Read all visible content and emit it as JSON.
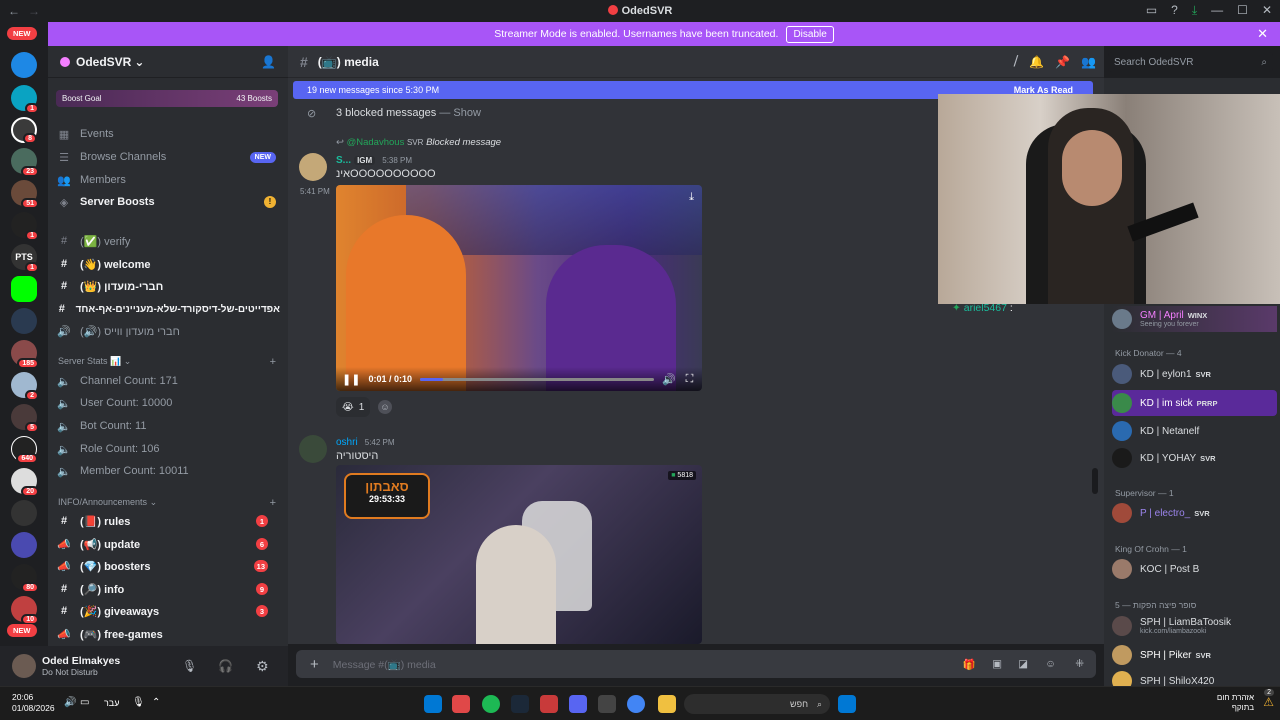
{
  "window": {
    "title": "OdedSVR"
  },
  "banner": {
    "text": "Streamer Mode is enabled. Usernames have been truncated.",
    "button": "Disable"
  },
  "guild_pills": {
    "top": "NEW",
    "bottom": "NEW"
  },
  "guild_badges": [
    "1",
    "8",
    "23",
    "51",
    "1",
    "1",
    "185",
    "2",
    "5",
    "640",
    "20",
    "80",
    "10",
    "1"
  ],
  "server": {
    "name": "OdedSVR",
    "boost_goal": "Boost Goal",
    "boost_count": "43 Boosts"
  },
  "nav": [
    {
      "label": "Events",
      "icon": "calendar-icon"
    },
    {
      "label": "Browse Channels",
      "icon": "browse-icon",
      "badge": "NEW"
    },
    {
      "label": "Members",
      "icon": "members-icon"
    },
    {
      "label": "Server Boosts",
      "icon": "boost-icon",
      "alert": "!"
    }
  ],
  "channels_top": [
    {
      "label": "(✅) verify",
      "muted": true
    },
    {
      "label": "(👋) welcome",
      "bold": true
    },
    {
      "label": "(👑) חברי-מועדון",
      "bold": true
    },
    {
      "label": "אפדייטים-של-דיסקורד-שלא-מעניינים-אף-אחד",
      "bold": true
    },
    {
      "label": "(🔊) חברי מועדון ווייס",
      "muted": true
    }
  ],
  "stats_category": "Server Stats 📊",
  "stats": [
    "Channel Count: 171",
    "User Count: 10000",
    "Bot Count: 11",
    "Role Count: 106",
    "Member Count: 10011"
  ],
  "info_category": "INFO/Announcements",
  "channels_info": [
    {
      "label": "(📕) rules",
      "badge": "1"
    },
    {
      "label": "(📢) update",
      "badge": "6"
    },
    {
      "label": "(💎) boosters",
      "badge": "13"
    },
    {
      "label": "(🔎) info",
      "badge": "9"
    },
    {
      "label": "(🎉) giveaways",
      "badge": "3"
    },
    {
      "label": "(🎮) free-games",
      "badge": ""
    }
  ],
  "user": {
    "name": "Oded Elmakyes",
    "status": "Do Not Disturb"
  },
  "channel": {
    "name": "(📺) media"
  },
  "search": {
    "placeholder": "Search OdedSVR"
  },
  "new_messages": {
    "text": "19 new messages since 5:30 PM",
    "action": "Mark As Read"
  },
  "blocked": {
    "text": "3 blocked messages",
    "show": "— Show"
  },
  "reply": {
    "user": "@Nadavhous",
    "tag": "SVR",
    "text": "Blocked message"
  },
  "msg1": {
    "author": "S...",
    "tag": "IGM",
    "time": "5:38 PM",
    "text": "אינOOOOOOOOOO",
    "time2": "5:41 PM"
  },
  "video1": {
    "progress": "0:01 / 0:10",
    "progress_fraction": 0.1
  },
  "reaction": {
    "count": "1"
  },
  "msg2": {
    "author": "oshri",
    "time": "5:42 PM",
    "text": "היסטוריה"
  },
  "video2": {
    "overlay": "סאבתון",
    "timer": "29:53:33",
    "viewers": "5818"
  },
  "composer": {
    "placeholder": "Message #(📺) media"
  },
  "member_floating": {
    "name": "ariel5467",
    "suffix": ":"
  },
  "members": [
    {
      "type": "row",
      "name": "GM | April",
      "tag": "WINX",
      "sub": "Seeing you forever",
      "color": "#f47fff",
      "hl": true
    },
    {
      "type": "cat",
      "name": "Kick Donator — 4"
    },
    {
      "type": "row",
      "name": "KD | eylon1",
      "tag": "SVR",
      "color": "#dbdee1"
    },
    {
      "type": "row",
      "name": "KD | im sick",
      "tag": "PRRP",
      "color": "#ffffff",
      "hl2": true
    },
    {
      "type": "row",
      "name": "KD | Netanelf",
      "tag": "",
      "color": "#dbdee1"
    },
    {
      "type": "row",
      "name": "KD | YOHAY",
      "tag": "SVR",
      "color": "#dbdee1"
    },
    {
      "type": "cat",
      "name": "Supervisor — 1"
    },
    {
      "type": "row",
      "name": "P | electro_",
      "tag": "SVR",
      "color": "#9b84ec"
    },
    {
      "type": "cat",
      "name": "King Of Crohn — 1"
    },
    {
      "type": "row",
      "name": "KOC | Post B",
      "tag": "",
      "color": "#dbdee1"
    },
    {
      "type": "cat",
      "name": "סופר פיצה הפקות — 5"
    },
    {
      "type": "row",
      "name": "SPH | LiamBaToosik",
      "tag": "",
      "sub": "kick.com/liambazooki",
      "color": "#dbdee1"
    },
    {
      "type": "row",
      "name": "SPH | Piker",
      "tag": "SVR",
      "color": "#ffffff"
    },
    {
      "type": "row",
      "name": "SPH | ShiloX420",
      "tag": "",
      "color": "#dbdee1"
    }
  ],
  "taskbar": {
    "time": "20:06",
    "date": "01/08/2026",
    "lang": "עבר",
    "search": "חפש",
    "weather_title": "אזהרת חום",
    "weather_sub": "בתוקף",
    "notif_count": "2"
  }
}
